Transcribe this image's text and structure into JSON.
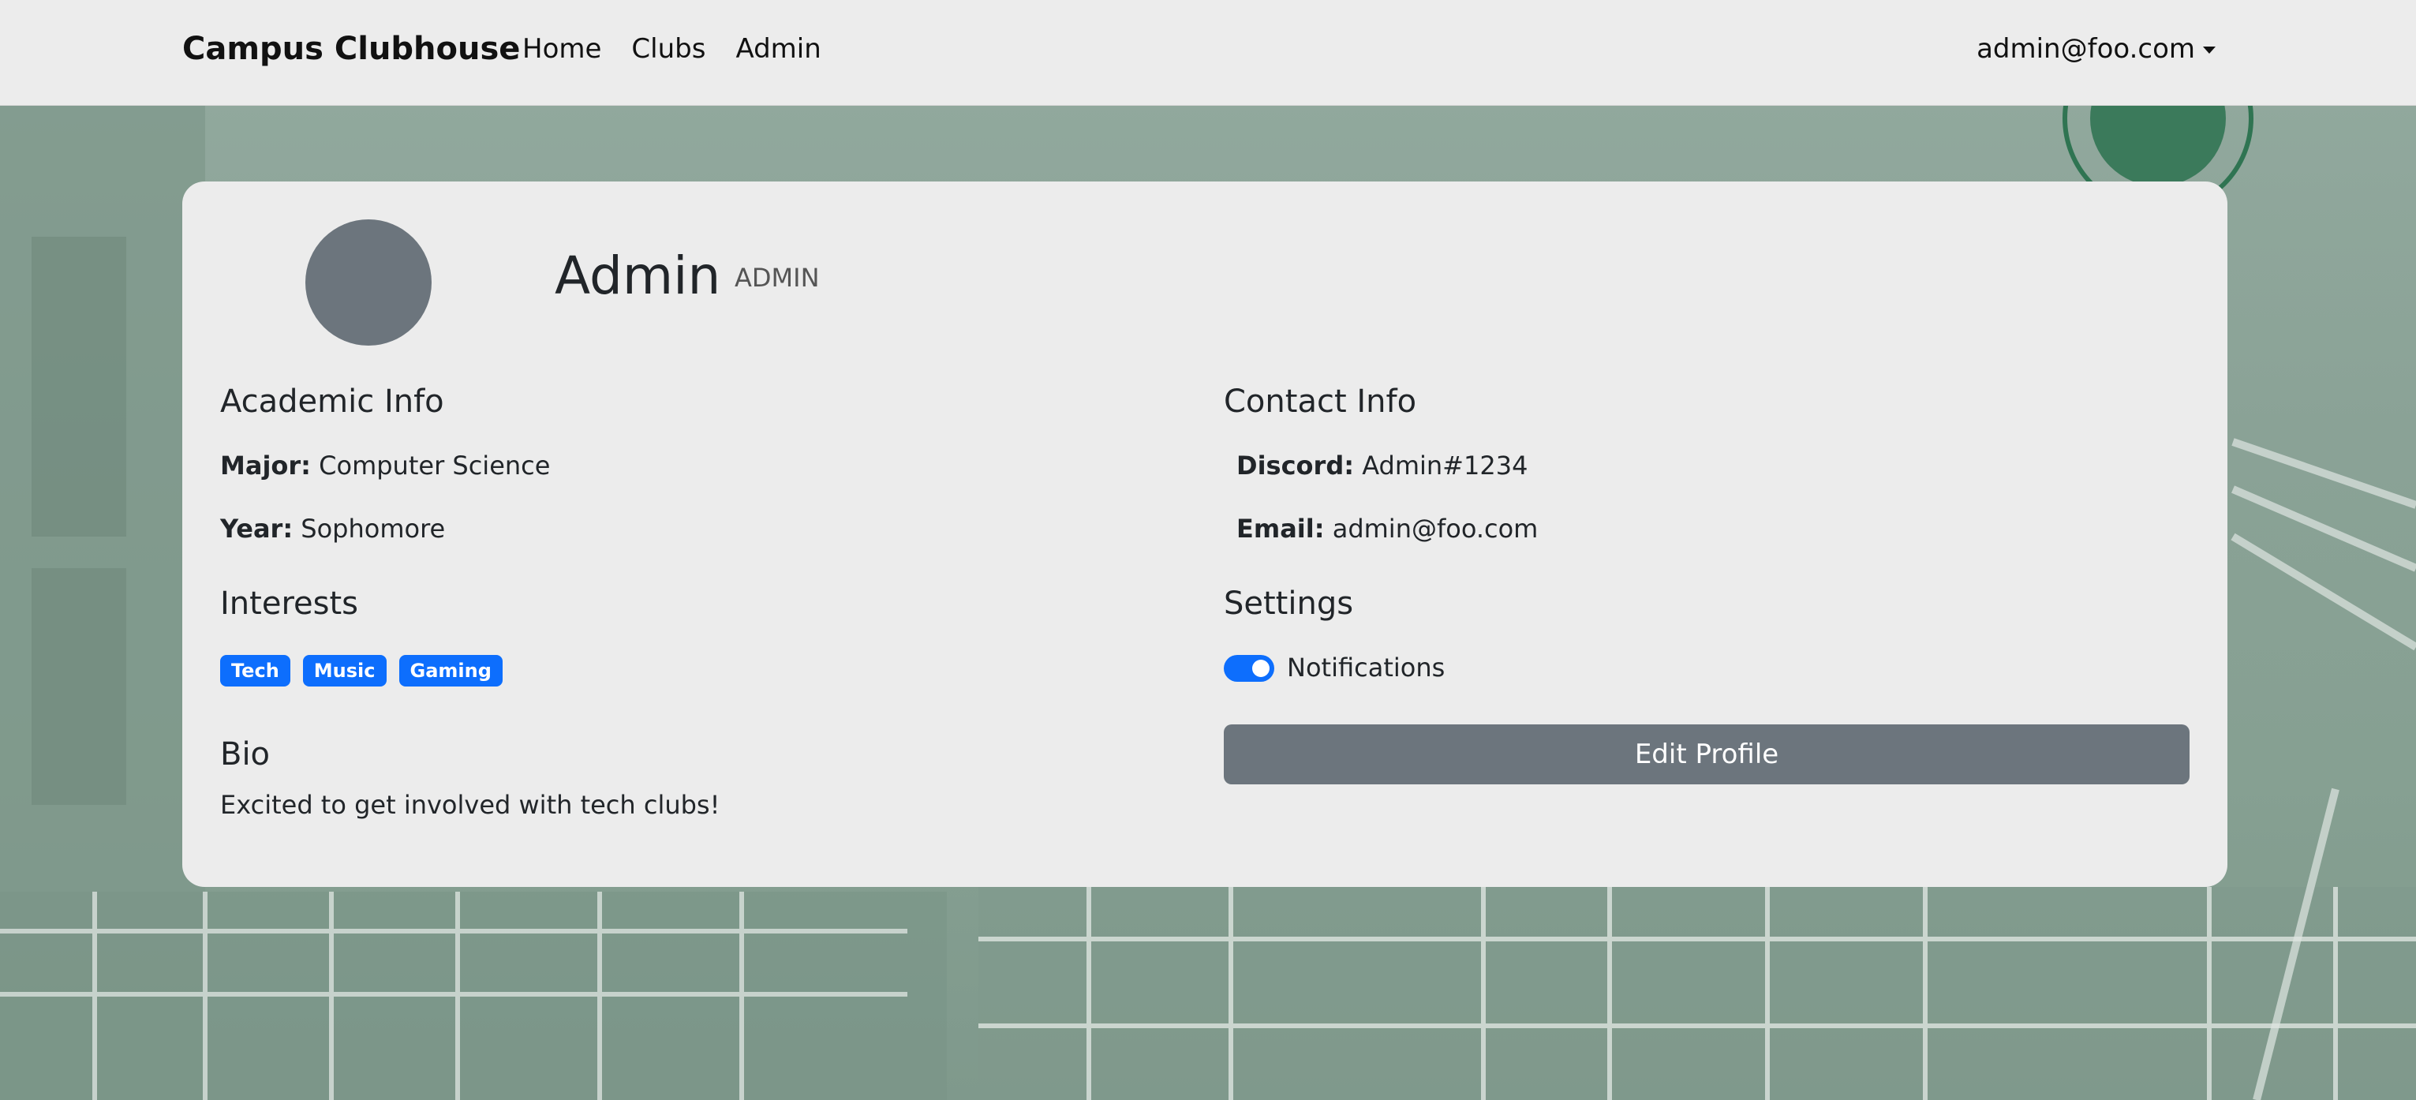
{
  "navbar": {
    "brand": "Campus Clubhouse",
    "links": [
      "Home",
      "Clubs",
      "Admin"
    ],
    "user_email": "admin@foo.com"
  },
  "profile": {
    "name": "Admin",
    "role": "ADMIN"
  },
  "academic": {
    "title": "Academic Info",
    "major_label": "Major:",
    "major_value": "Computer Science",
    "year_label": "Year:",
    "year_value": "Sophomore"
  },
  "interests": {
    "title": "Interests",
    "tags": [
      "Tech",
      "Music",
      "Gaming"
    ]
  },
  "bio": {
    "title": "Bio",
    "text": "Excited to get involved with tech clubs!"
  },
  "contact": {
    "title": "Contact Info",
    "discord_label": "Discord:",
    "discord_value": "Admin#1234",
    "email_label": "Email:",
    "email_value": "admin@foo.com"
  },
  "settings": {
    "title": "Settings",
    "notifications_label": "Notifications",
    "notifications_on": true
  },
  "actions": {
    "edit_profile": "Edit Profile"
  },
  "colors": {
    "primary": "#0d6efd",
    "secondary": "#6c757d",
    "navbar_bg": "#ececec",
    "card_bg": "#ececec"
  }
}
